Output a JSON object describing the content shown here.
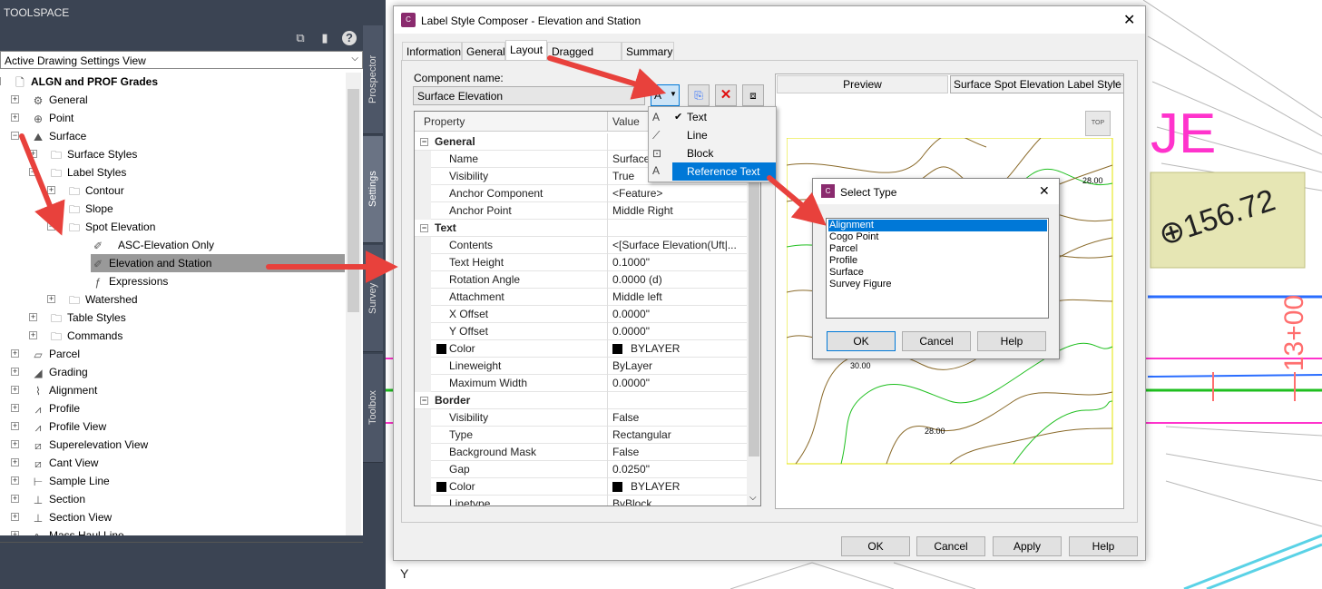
{
  "toolspace": {
    "title": "TOOLSPACE",
    "view_selector": "Active Drawing Settings View",
    "side_tabs": [
      "Prospector",
      "Settings",
      "Survey",
      "Toolbox"
    ],
    "tree": [
      {
        "label": "ALGN and PROF Grades",
        "bold": true
      },
      {
        "label": "General"
      },
      {
        "label": "Point"
      },
      {
        "label": "Surface"
      },
      {
        "label": "Surface Styles"
      },
      {
        "label": "Label Styles"
      },
      {
        "label": "Contour"
      },
      {
        "label": "Slope"
      },
      {
        "label": "Spot Elevation"
      },
      {
        "label": "ASC-Elevation Only"
      },
      {
        "label": "Elevation and Station"
      },
      {
        "label": "Expressions"
      },
      {
        "label": "Watershed"
      },
      {
        "label": "Table Styles"
      },
      {
        "label": "Commands"
      },
      {
        "label": "Parcel"
      },
      {
        "label": "Grading"
      },
      {
        "label": "Alignment"
      },
      {
        "label": "Profile"
      },
      {
        "label": "Profile View"
      },
      {
        "label": "Superelevation View"
      },
      {
        "label": "Cant View"
      },
      {
        "label": "Sample Line"
      },
      {
        "label": "Section"
      },
      {
        "label": "Section View"
      },
      {
        "label": "Mass Haul Line"
      }
    ]
  },
  "dialog": {
    "title": "Label Style Composer - Elevation and Station",
    "tabs": [
      "Information",
      "General",
      "Layout",
      "Dragged State",
      "Summary"
    ],
    "active_tab": "Layout",
    "component_name_label": "Component name:",
    "component_name_value": "Surface Elevation",
    "grid_headers": {
      "property": "Property",
      "value": "Value"
    },
    "rows": [
      {
        "type": "cat",
        "name": "General",
        "value": ""
      },
      {
        "name": "Name",
        "value": "Surface"
      },
      {
        "name": "Visibility",
        "value": "True"
      },
      {
        "name": "Anchor Component",
        "value": "<Feature>"
      },
      {
        "name": "Anchor Point",
        "value": "Middle Right"
      },
      {
        "type": "cat",
        "name": "Text",
        "value": ""
      },
      {
        "name": "Contents",
        "value": "<[Surface Elevation(Uft|..."
      },
      {
        "name": "Text Height",
        "value": "0.1000\""
      },
      {
        "name": "Rotation Angle",
        "value": "0.0000 (d)"
      },
      {
        "name": "Attachment",
        "value": "Middle left"
      },
      {
        "name": "X Offset",
        "value": "0.0000\""
      },
      {
        "name": "Y Offset",
        "value": "0.0000\""
      },
      {
        "name": "Color",
        "value": "BYLAYER",
        "swatch": true
      },
      {
        "name": "Lineweight",
        "value": "ByLayer"
      },
      {
        "name": "Maximum Width",
        "value": "0.0000\""
      },
      {
        "type": "cat",
        "name": "Border",
        "value": ""
      },
      {
        "name": "Visibility",
        "value": "False"
      },
      {
        "name": "Type",
        "value": "Rectangular"
      },
      {
        "name": "Background Mask",
        "value": "False"
      },
      {
        "name": "Gap",
        "value": "0.0250\""
      },
      {
        "name": "Color",
        "value": "BYLAYER",
        "swatch": true
      },
      {
        "name": "Linetype",
        "value": "ByBlock"
      }
    ],
    "preview_label": "Preview",
    "preview_style": "Surface Spot Elevation Label Style",
    "view_cube_label": "TOP",
    "contour_labels": [
      "28.00",
      "30.00",
      "28.00"
    ],
    "buttons": {
      "ok": "OK",
      "cancel": "Cancel",
      "apply": "Apply",
      "help": "Help"
    }
  },
  "component_menu": {
    "items": [
      {
        "label": "Text",
        "checked": true
      },
      {
        "label": "Line"
      },
      {
        "label": "Block"
      },
      {
        "label": "Reference Text",
        "highlighted": true
      }
    ]
  },
  "select_type": {
    "title": "Select Type",
    "items": [
      "Alignment",
      "Cogo Point",
      "Parcel",
      "Profile",
      "Surface",
      "Survey Figure"
    ],
    "selected": "Alignment",
    "buttons": {
      "ok": "OK",
      "cancel": "Cancel",
      "help": "Help"
    }
  },
  "drawing": {
    "label_text": "156.72",
    "station_text": "13+00",
    "big_text": "JE",
    "axis_text": "Y"
  },
  "colors": {
    "panel": "#3b4453",
    "selection": "#0078d7",
    "arrow": "#e8413c",
    "magenta": "#ff33cc"
  }
}
